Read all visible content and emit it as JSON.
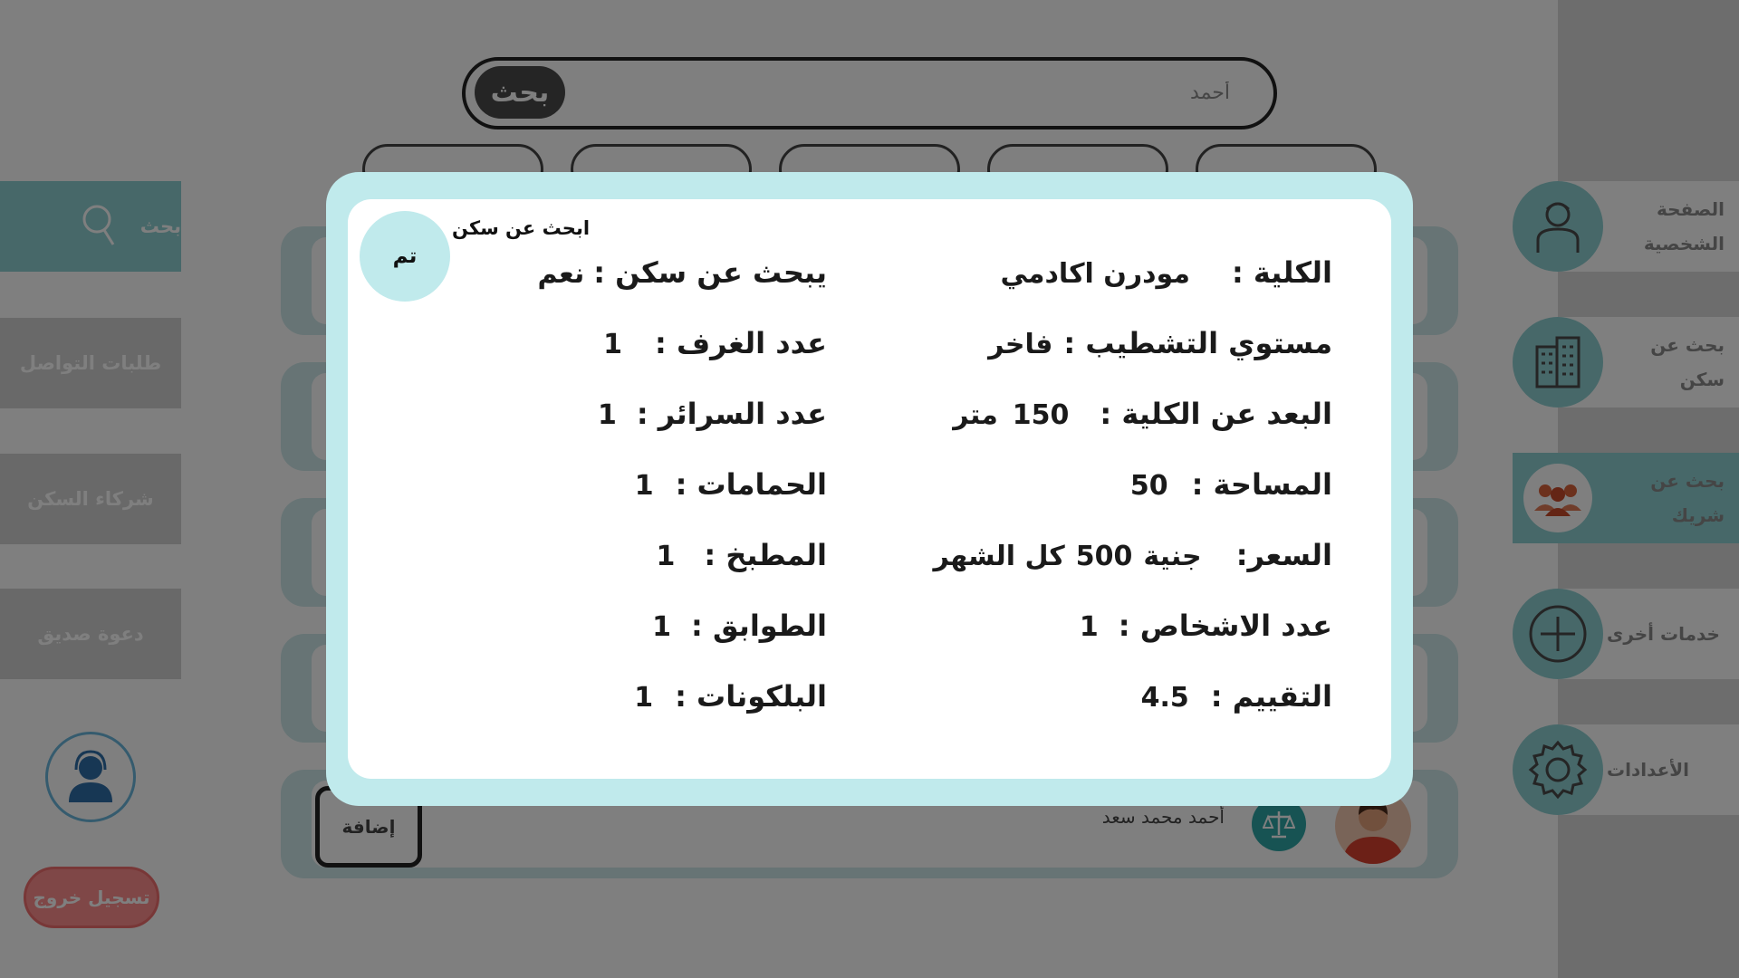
{
  "colors": {
    "accent": "#8fd1d3",
    "modal_frame": "#c0eaec",
    "logout": "#ff8f8f",
    "overlay": "rgba(0,0,0,0.5)"
  },
  "sidebar": {
    "items": [
      {
        "label": "الصفحة الشخصية",
        "icon": "user-icon",
        "active": false
      },
      {
        "label": "بحث عن سكن",
        "icon": "building-icon",
        "active": false
      },
      {
        "label": "بحث عن شريك",
        "icon": "people-icon",
        "active": true
      },
      {
        "label": "خدمات أخرى",
        "icon": "plus-icon",
        "active": false
      },
      {
        "label": "الأعدادات",
        "icon": "gear-icon",
        "active": false
      }
    ]
  },
  "left_menu": {
    "search_label": "بحث",
    "items": [
      "طلبات التواصل",
      "شركاء السكن",
      "دعوة صديق"
    ],
    "support_icon": "headset-icon",
    "logout_label": "تسجيل خروج"
  },
  "search": {
    "button_label": "بحث",
    "placeholder": "أحمد"
  },
  "results": {
    "add_label": "إضافة",
    "last_name": "أحمد محمد سعد"
  },
  "modal": {
    "title": "ابحث عن سكن",
    "done_label": "تم",
    "right_rows": [
      {
        "label": "الكلية :",
        "value": "مودرن اكادمي"
      },
      {
        "label": "مستوي التشطيب :",
        "value": "فاخر"
      },
      {
        "label": "البعد عن الكلية :",
        "value": "150",
        "unit": "متر"
      },
      {
        "label": "المساحة :",
        "value": "50"
      },
      {
        "label": "السعر:",
        "value": "جنية",
        "amount": "500",
        "suffix": "كل الشهر"
      },
      {
        "label": "عدد الاشخاص :",
        "value": "1"
      },
      {
        "label": "التقييم :",
        "value": "4.5"
      }
    ],
    "left_rows": [
      {
        "label": "يبحث عن سكن :",
        "value": "نعم"
      },
      {
        "label": "عدد الغرف :",
        "value": "1"
      },
      {
        "label": "عدد السرائر :",
        "value": "1"
      },
      {
        "label": "الحمامات :",
        "value": "1"
      },
      {
        "label": "المطبخ :",
        "value": "1"
      },
      {
        "label": "الطوابق :",
        "value": "1"
      },
      {
        "label": "البلكونات :",
        "value": "1"
      }
    ]
  }
}
